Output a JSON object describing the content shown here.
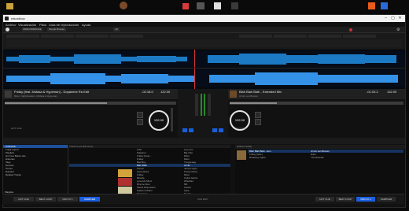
{
  "desktop": {
    "icons": [
      "folder-icon",
      "app-icon",
      "app-icon",
      "app-icon",
      "app-icon",
      "app-icon",
      "app-icon",
      "app-icon",
      "app-icon",
      "app-icon"
    ]
  },
  "window": {
    "title": "rekordbox",
    "menu": [
      "Archivo",
      "Visualización",
      "Pista",
      "Lista de reproducción",
      "Ayuda"
    ]
  },
  "toolbar": {
    "mode": "PERFORMANCE",
    "zoom": "10",
    "preset": "Simple Browse"
  },
  "decks": {
    "left": {
      "title": "Friday (feat. Mufasa & Hypeman) - Dopamine Re-Edit",
      "artist": "Riton, Nightcrawlers, Mufasa & Hypeman",
      "time": "-02:18.0",
      "bpm": "122.00",
      "jog_bpm": "132.00",
      "key": "Fm",
      "hot_cue": "HOT CUE"
    },
    "right": {
      "title": "Blah Blah Blah - Extended Mix",
      "artist": "Armin van Buuren",
      "time": "-01:03.2",
      "bpm": "132.00",
      "jog_bpm": "132.00",
      "key": "Gm",
      "hot_cue": "HOT CUE"
    }
  },
  "browser": {
    "tree": [
      {
        "label": "Collection",
        "selected": true
      },
      {
        "label": "Track Import",
        "selected": false
      },
      {
        "label": "Playlists",
        "selected": false
      },
      {
        "label": "Hot Cue Bank Lists",
        "selected": false
      },
      {
        "label": "Histories",
        "selected": false
      },
      {
        "label": "Tags",
        "selected": false
      },
      {
        "label": "Devices",
        "selected": false
      },
      {
        "label": "iTunes",
        "selected": false
      },
      {
        "label": "Explorer",
        "selected": false
      },
      {
        "label": "Related Tracks",
        "selected": false
      }
    ],
    "list_header": "Track Count (85 items)",
    "rows": [
      {
        "title": "GTA",
        "artist": "Lorry Inc",
        "hl": false
      },
      {
        "title": "Sakpiner",
        "artist": "Big Vibe",
        "hl": false
      },
      {
        "title": "Friday (Feat...",
        "artist": "Riton",
        "hl": false
      },
      {
        "title": "Friday",
        "artist": "Riton",
        "hl": false
      },
      {
        "title": "Bad Boy",
        "artist": "Tungevaag",
        "hl": false
      },
      {
        "title": "Blah Blah",
        "artist": "Armin",
        "hl": true
      },
      {
        "title": "Ferrari",
        "artist": "James Hype",
        "hl": false
      },
      {
        "title": "Hypnotized",
        "artist": "Purple Disco",
        "hl": false
      },
      {
        "title": "Friday",
        "artist": "Riton",
        "hl": false
      },
      {
        "title": "Miracle",
        "artist": "Calvin Harris",
        "hl": false
      },
      {
        "title": "Lose My Mind",
        "artist": "Whethan",
        "hl": false
      },
      {
        "title": "Rhyme Dust",
        "artist": "MK",
        "hl": false
      },
      {
        "title": "Sweet Disposition",
        "artist": "Axwell",
        "hl": false
      },
      {
        "title": "Padam Padam",
        "artist": "Kylie",
        "hl": false
      },
      {
        "title": "Tomorrow",
        "artist": "Deorro",
        "hl": false
      },
      {
        "title": "Shed A Light",
        "artist": "Robin S",
        "hl": false
      }
    ]
  },
  "side_list": {
    "header": "Archivo (Cola)",
    "rows": [
      {
        "title": "Blah Blah Blah - Ext...",
        "artist": "Armin van Buuren",
        "hl": true
      },
      {
        "title": "Friday (feat.)",
        "artist": "Riton",
        "hl": false
      },
      {
        "title": "Breaking Lights",
        "artist": "The Rascals",
        "hl": false
      }
    ]
  },
  "bottom": {
    "playlists_label": "Playlists",
    "left_buttons": [
      "HOT CUE",
      "BEAT LOOP",
      "PAD FX 1",
      "SAMPLER"
    ],
    "center": "PAD EDIT",
    "right_buttons": [
      "HOT CUE",
      "BEAT LOOP",
      "PAD FX 1",
      "SAMPLER"
    ]
  }
}
